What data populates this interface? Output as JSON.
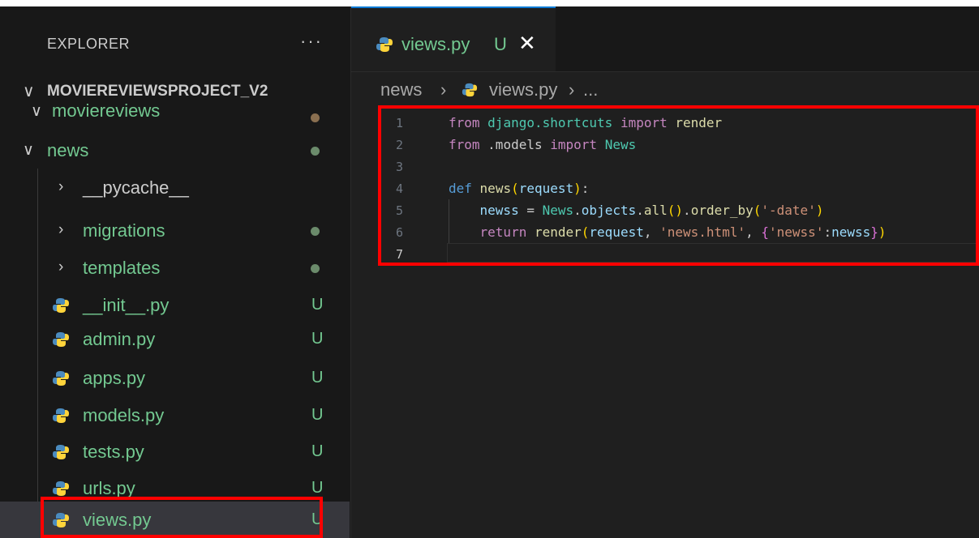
{
  "explorer": {
    "title": "EXPLORER",
    "more": "···",
    "project": "MOVIEREVIEWSPROJECT_V2",
    "items": [
      {
        "label": "moviereviews"
      },
      {
        "label": "news"
      },
      {
        "label": "__pycache__"
      },
      {
        "label": "migrations"
      },
      {
        "label": "templates"
      },
      {
        "label": "__init__.py",
        "badge": "U"
      },
      {
        "label": "admin.py",
        "badge": "U"
      },
      {
        "label": "apps.py",
        "badge": "U"
      },
      {
        "label": "models.py",
        "badge": "U"
      },
      {
        "label": "tests.py",
        "badge": "U"
      },
      {
        "label": "urls.py",
        "badge": "U"
      },
      {
        "label": "views.py",
        "badge": "U"
      }
    ]
  },
  "tab": {
    "name": "views.py",
    "badge": "U",
    "close": "✕"
  },
  "breadcrumb": {
    "folder": "news",
    "file": "views.py",
    "more": "..."
  },
  "code": {
    "line_numbers": [
      "1",
      "2",
      "3",
      "4",
      "5",
      "6",
      "7"
    ]
  },
  "colors": {
    "accent": "#0078d4",
    "git_untracked": "#73c991",
    "highlight": "#ff0000"
  }
}
